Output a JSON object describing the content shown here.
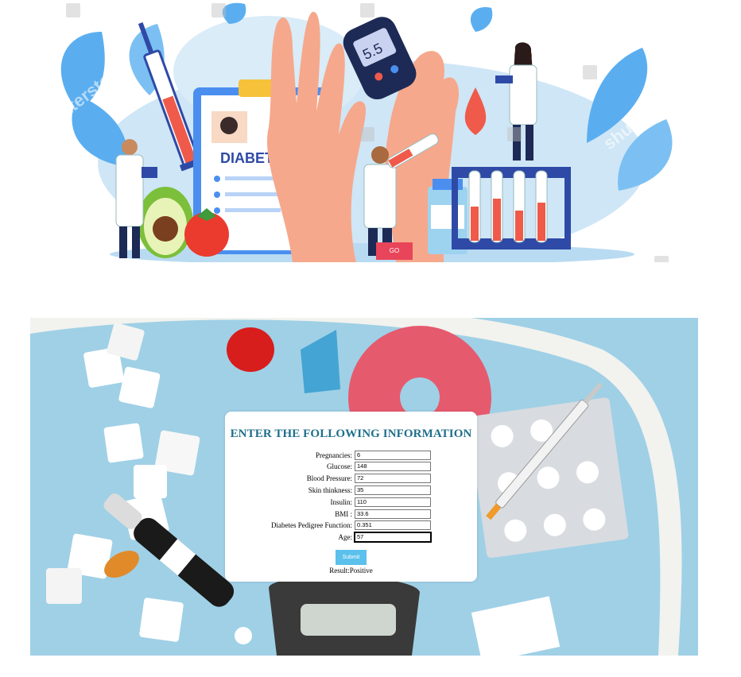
{
  "hero": {
    "poster_title": "DIABETES",
    "meter_reading": "5.5",
    "go_button": "GO",
    "watermark": "shutterstock"
  },
  "form": {
    "title": "ENTER THE FOLLOWING INFORMATION",
    "fields": [
      {
        "label": "Pregnancies:",
        "value": "6"
      },
      {
        "label": "Glucose:",
        "value": "148"
      },
      {
        "label": "Blood Pressure:",
        "value": "72"
      },
      {
        "label": "Skin thinkness:",
        "value": "35"
      },
      {
        "label": "Insulin:",
        "value": "110"
      },
      {
        "label": "BMI :",
        "value": "33.6"
      },
      {
        "label": "Diabetes Pedigree Function:",
        "value": "0.351"
      },
      {
        "label": "Age:",
        "value": "57"
      }
    ],
    "submit_label": "Submit",
    "result_text": "Result:Positive"
  },
  "colors": {
    "title": "#1f6f8b",
    "submit": "#5bc0eb",
    "go": "#e8455a",
    "photo_bg": "#9fd0e6"
  }
}
